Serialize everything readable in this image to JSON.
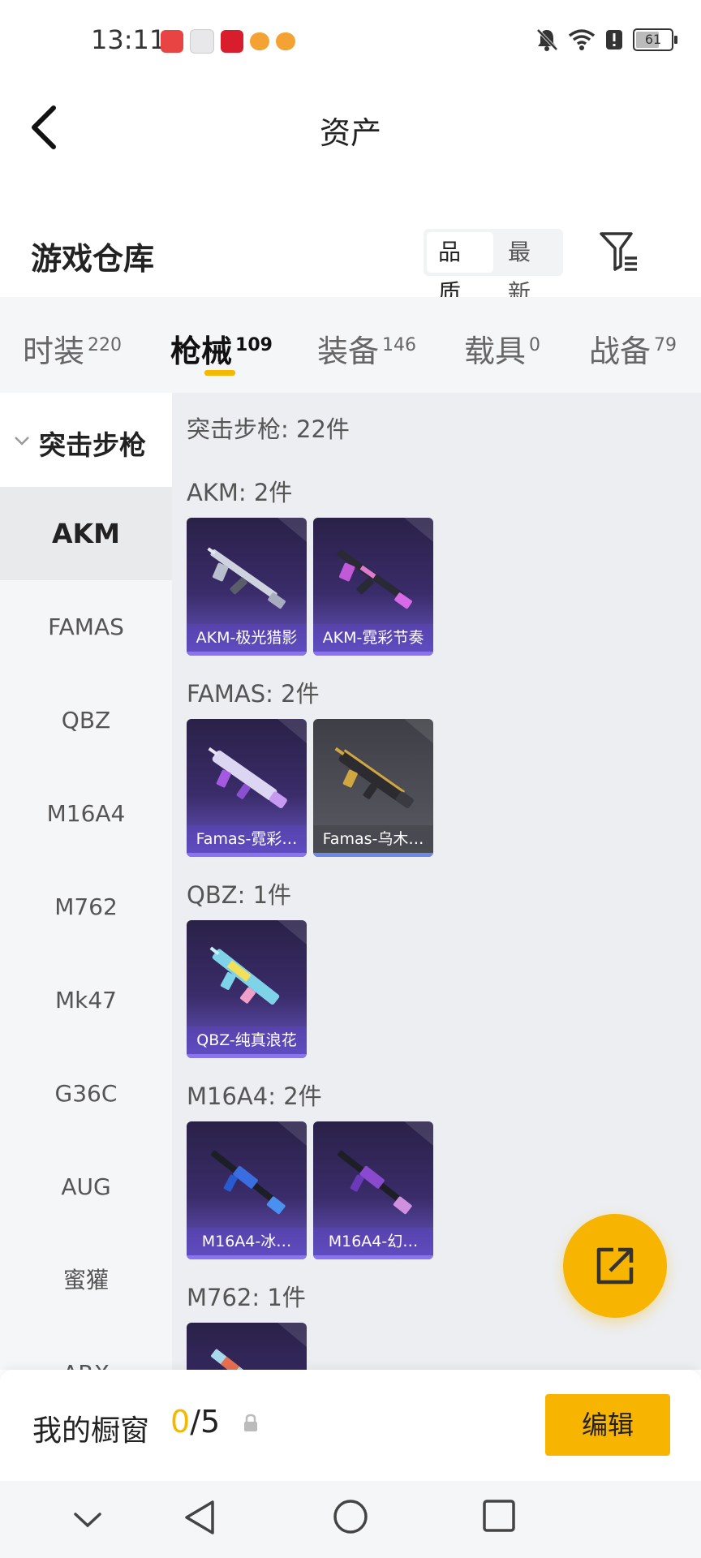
{
  "status_bar": {
    "time": "13:11",
    "battery": "61",
    "battery_level": 0.61,
    "notification_icons": [
      "huawei-app-icon",
      "gift-box-icon",
      "red-app-icon",
      "orange-app-icon",
      "orange-app-icon"
    ],
    "right_icons": [
      "mute-bell-icon",
      "wifi-icon",
      "alert-icon",
      "battery-icon"
    ]
  },
  "header": {
    "title": "资产"
  },
  "warehouse": {
    "title": "游戏仓库",
    "sort": {
      "quality": "品质",
      "newest": "最新",
      "active": "quality"
    }
  },
  "tabs": [
    {
      "label": "时装",
      "count": "220"
    },
    {
      "label": "枪械",
      "count": "109",
      "active": true
    },
    {
      "label": "装备",
      "count": "146"
    },
    {
      "label": "载具",
      "count": "0"
    },
    {
      "label": "战备",
      "count": "79"
    }
  ],
  "sidebar": {
    "group": "突击步枪",
    "items": [
      "AKM",
      "FAMAS",
      "QBZ",
      "M16A4",
      "M762",
      "Mk47",
      "G36C",
      "AUG",
      "蜜獾",
      "ARX"
    ],
    "active": "AKM"
  },
  "content": {
    "heading": "突击步枪: 22件",
    "sections": [
      {
        "title": "AKM: 2件",
        "items": [
          {
            "name": "AKM-极光猎影",
            "color": "purple"
          },
          {
            "name": "AKM-霓彩节奏",
            "color": "purple"
          }
        ]
      },
      {
        "title": "FAMAS: 2件",
        "items": [
          {
            "name": "Famas-霓彩…",
            "color": "purple"
          },
          {
            "name": "Famas-乌木…",
            "color": "gray"
          }
        ]
      },
      {
        "title": "QBZ: 1件",
        "items": [
          {
            "name": "QBZ-纯真浪花",
            "color": "purple"
          }
        ]
      },
      {
        "title": "M16A4: 2件",
        "items": [
          {
            "name": "M16A4-冰…",
            "color": "purple"
          },
          {
            "name": "M16A4-幻…",
            "color": "purple"
          }
        ]
      },
      {
        "title": "M762: 1件",
        "items": [
          {
            "name": "",
            "color": "purple"
          }
        ]
      }
    ]
  },
  "bottom_panel": {
    "label": "我的橱窗",
    "count_current": "0",
    "count_sep_total": "/5",
    "edit_label": "编辑"
  },
  "colors": {
    "accent": "#f7b400",
    "card_purple": "#3a2c6a",
    "card_gray": "#55555e"
  }
}
